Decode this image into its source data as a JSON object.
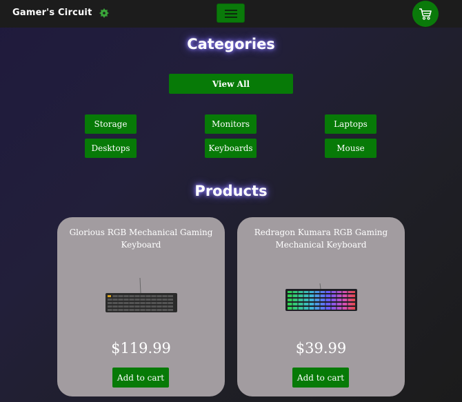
{
  "brand": {
    "name": "Gamer's Circuit"
  },
  "nav": {
    "menu_icon": "hamburger-menu-icon",
    "cart_icon": "shopping-cart-icon"
  },
  "categories": {
    "title": "Categories",
    "view_all": "View All",
    "items": [
      "Storage",
      "Monitors",
      "Laptops",
      "Desktops",
      "Keyboards",
      "Mouse"
    ]
  },
  "products": {
    "title": "Products",
    "items": [
      {
        "name": "Glorious RGB Mechanical Gaming Keyboard",
        "price": "$119.99",
        "button": "Add to cart"
      },
      {
        "name": "Redragon Kumara RGB Gaming Mechanical Keyboard",
        "price": "$39.99",
        "button": "Add to cart"
      }
    ]
  },
  "colors": {
    "accent_green": "#077a07",
    "card_bg": "#a29ca0",
    "navbar_bg": "#1c1c1c"
  }
}
